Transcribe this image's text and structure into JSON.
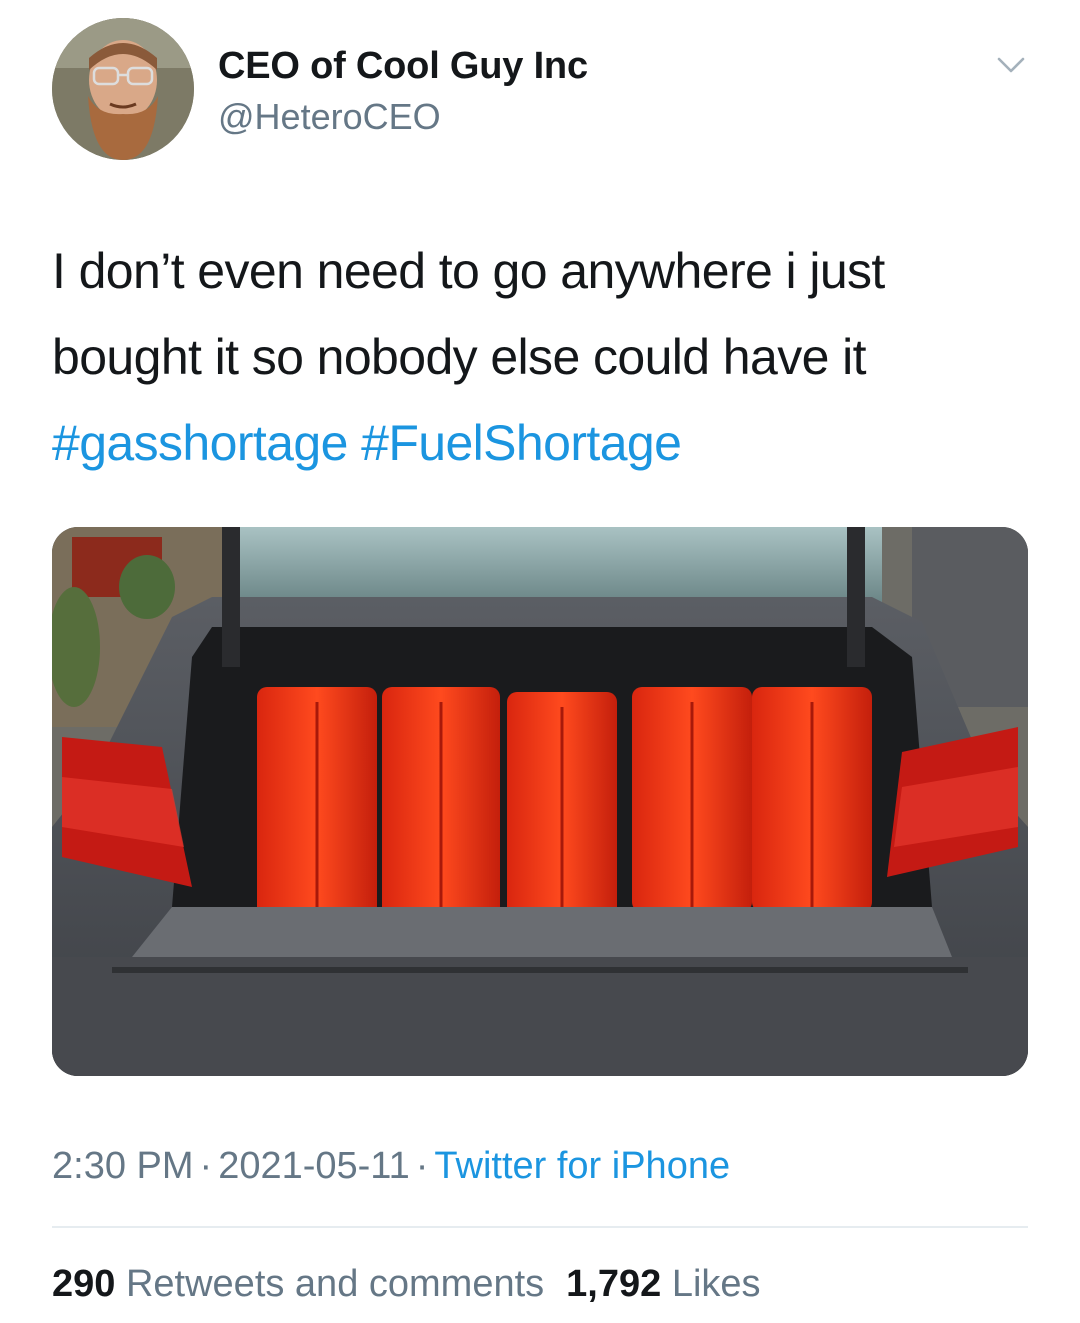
{
  "tweet": {
    "author": {
      "display_name": "CEO of Cool Guy Inc",
      "handle": "@HeteroCEO"
    },
    "text_line1": "I don’t even need to go anywhere i just",
    "text_line2": "bought it so nobody else could have it",
    "hashtags": [
      "#gasshortage",
      "#FuelShortage"
    ],
    "media_icon": "photo of car trunk holding five red jerry cans",
    "meta": {
      "time": "2:30 PM",
      "separator": "·",
      "date": "2021-05-11",
      "source": "Twitter for iPhone"
    },
    "stats": {
      "retweets_count": "290",
      "retweets_label": "Retweets and comments",
      "likes_count": "1,792",
      "likes_label": "Likes"
    }
  },
  "colors": {
    "link": "#1b95e0",
    "secondary_text": "#657786",
    "primary_text": "#14171a",
    "divider": "#e6ecf0"
  }
}
